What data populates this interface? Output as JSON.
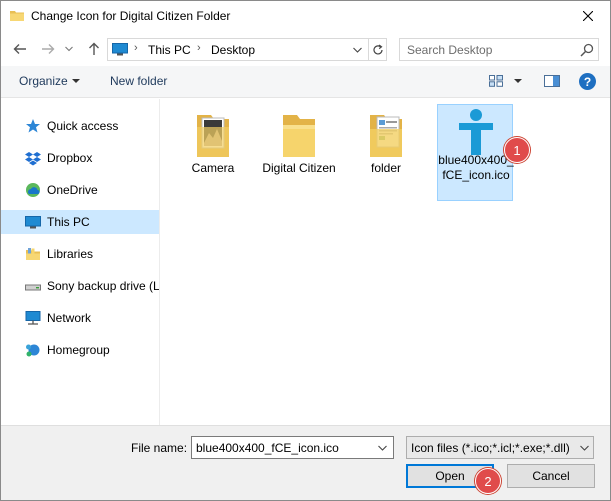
{
  "window": {
    "title": "Change Icon for Digital Citizen Folder"
  },
  "address": {
    "crumbs": [
      "This PC",
      "Desktop"
    ]
  },
  "search": {
    "placeholder": "Search Desktop"
  },
  "toolbar": {
    "organize_label": "Organize",
    "new_folder_label": "New folder",
    "help_label": "?"
  },
  "nav": {
    "items": [
      {
        "label": "Quick access",
        "icon": "star-icon"
      },
      {
        "label": "Dropbox",
        "icon": "dropbox-icon"
      },
      {
        "label": "OneDrive",
        "icon": "onedrive-icon"
      },
      {
        "label": "This PC",
        "icon": "computer-icon",
        "selected": true
      },
      {
        "label": "Libraries",
        "icon": "libraries-icon"
      },
      {
        "label": "Sony backup drive (L:",
        "icon": "drive-icon"
      },
      {
        "label": "Network",
        "icon": "network-icon"
      },
      {
        "label": "Homegroup",
        "icon": "homegroup-icon"
      }
    ]
  },
  "files": {
    "items": [
      {
        "label": "Camera",
        "icon": "folder-photos-icon"
      },
      {
        "label": "Digital Citizen",
        "icon": "folder-icon"
      },
      {
        "label": "folder",
        "icon": "folder-docs-icon"
      },
      {
        "label": "blue400x400_fCE_icon.ico",
        "icon": "ico-file-icon",
        "selected": true
      }
    ]
  },
  "annotations": {
    "badge1": "1",
    "badge2": "2"
  },
  "footer": {
    "filename_label": "File name:",
    "filename_value": "blue400x400_fCE_icon.ico",
    "filter_value": "Icon files (*.ico;*.icl;*.exe;*.dll)",
    "open_label": "Open",
    "cancel_label": "Cancel"
  },
  "colors": {
    "accent": "#0078d7",
    "selection": "#cce8ff",
    "badge": "#e04b4b"
  }
}
